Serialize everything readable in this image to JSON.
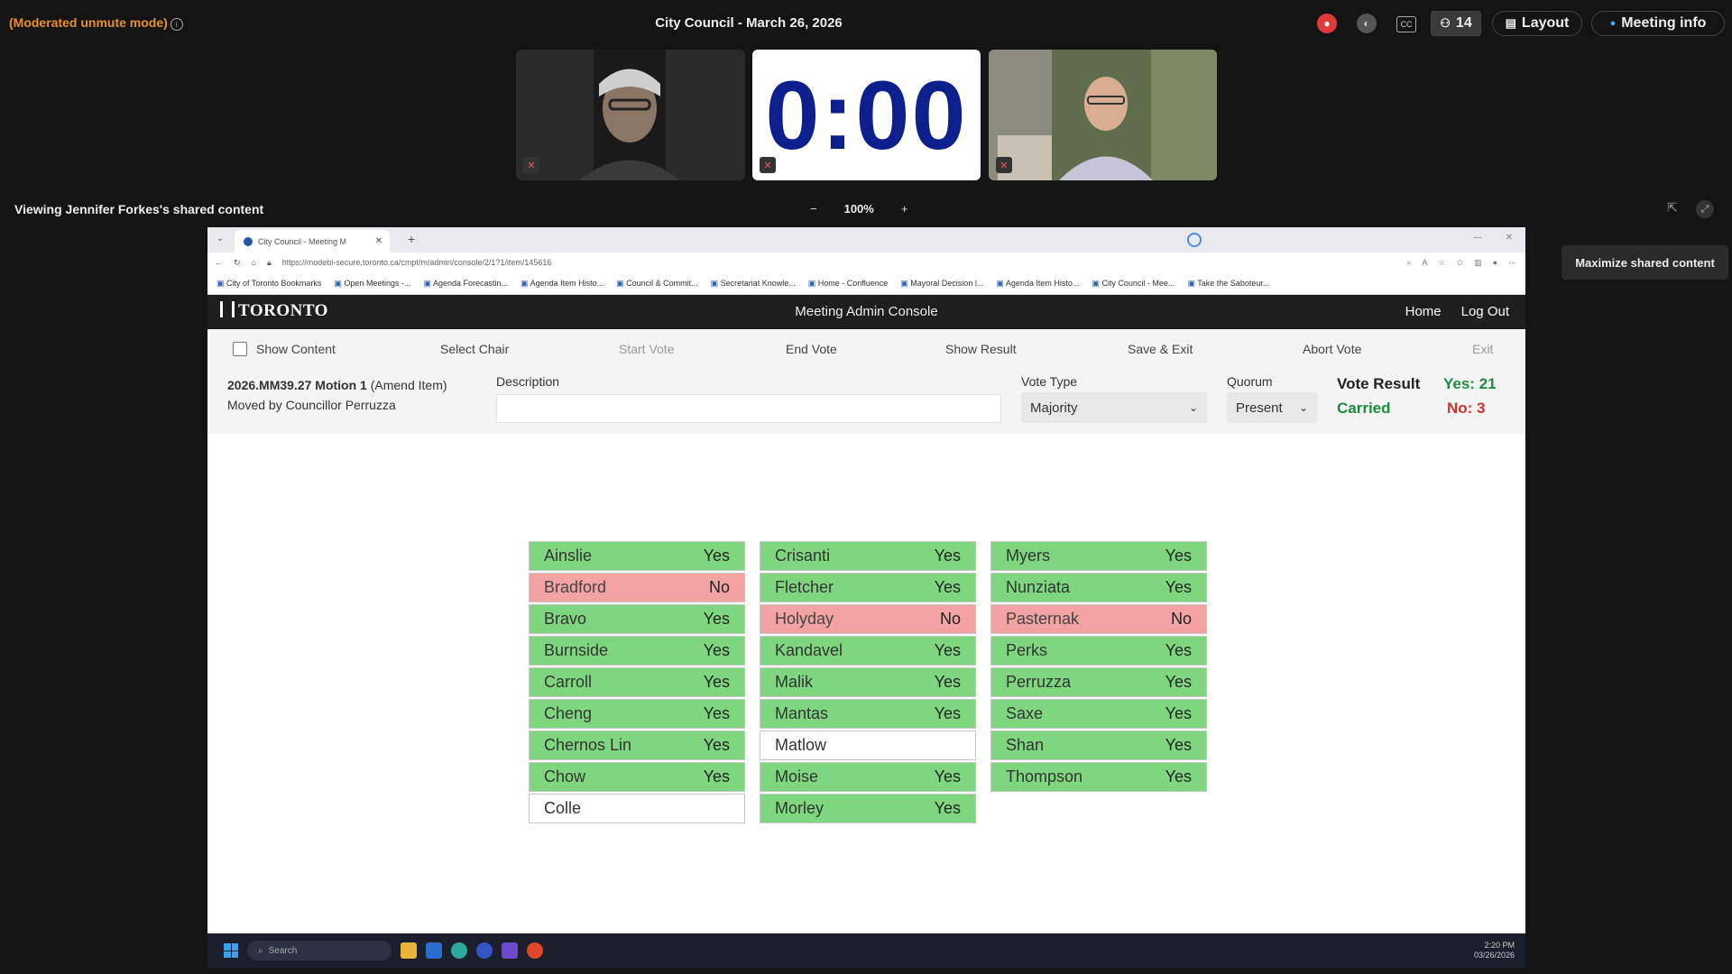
{
  "meeting": {
    "mode_label": "(Moderated unmute mode)",
    "title": "City Council - March 26, 2026",
    "participants_count": "14",
    "layout_label": "Layout",
    "meeting_info_label": "Meeting info",
    "timer": "0:00",
    "viewing_label": "Viewing Jennifer Forkes's shared content",
    "zoom_level": "100%",
    "zoom_minus": "−",
    "zoom_plus": "+",
    "tooltip": "Maximize shared content"
  },
  "browser": {
    "tab_title": "City Council - Meeting M",
    "url": "https://modebi-secure.toronto.ca/cmpt/m/admin/console/2/1?1/item/145616",
    "bookmarks": [
      "City of Toronto Bookmarks",
      "Open Meetings -...",
      "Agenda Forecastin...",
      "Agenda Item Histo...",
      "Council & Commit...",
      "Secretariat Knowle...",
      "Home - Confluence",
      "Mayoral Decision l...",
      "Agenda Item Histo...",
      "City Council - Mee...",
      "Take the Saboteur..."
    ]
  },
  "app": {
    "logo": "TORONTO",
    "console_title": "Meeting Admin Console",
    "nav_home": "Home",
    "nav_logout": "Log Out",
    "toolbar": {
      "show_content": "Show Content",
      "select_chair": "Select Chair",
      "start_vote": "Start Vote",
      "end_vote": "End Vote",
      "show_result": "Show Result",
      "save_exit": "Save & Exit",
      "abort_vote": "Abort Vote",
      "exit": "Exit"
    },
    "motion": {
      "id": "2026.MM39.27 Motion 1",
      "type": "(Amend Item)",
      "moved_by": "Moved by Councillor Perruzza",
      "description_label": "Description",
      "vote_type_label": "Vote Type",
      "vote_type_value": "Majority",
      "quorum_label": "Quorum",
      "quorum_value": "Present",
      "vote_result_label": "Vote Result",
      "result_status": "Carried",
      "yes_count": "Yes: 21",
      "no_count": "No: 3"
    },
    "colors": {
      "yes": "#7ed77f",
      "no": "#f3a4a2",
      "carried": "#1f8b3c",
      "no_text": "#d0312d"
    },
    "votes": [
      [
        {
          "name": "Ainslie",
          "vote": "Yes"
        },
        {
          "name": "Bradford",
          "vote": "No"
        },
        {
          "name": "Bravo",
          "vote": "Yes"
        },
        {
          "name": "Burnside",
          "vote": "Yes"
        },
        {
          "name": "Carroll",
          "vote": "Yes"
        },
        {
          "name": "Cheng",
          "vote": "Yes"
        },
        {
          "name": "Chernos Lin",
          "vote": "Yes"
        },
        {
          "name": "Chow",
          "vote": "Yes"
        },
        {
          "name": "Colle",
          "vote": ""
        }
      ],
      [
        {
          "name": "Crisanti",
          "vote": "Yes"
        },
        {
          "name": "Fletcher",
          "vote": "Yes"
        },
        {
          "name": "Holyday",
          "vote": "No"
        },
        {
          "name": "Kandavel",
          "vote": "Yes"
        },
        {
          "name": "Malik",
          "vote": "Yes"
        },
        {
          "name": "Mantas",
          "vote": "Yes"
        },
        {
          "name": "Matlow",
          "vote": ""
        },
        {
          "name": "Moise",
          "vote": "Yes"
        },
        {
          "name": "Morley",
          "vote": "Yes"
        }
      ],
      [
        {
          "name": "Myers",
          "vote": "Yes"
        },
        {
          "name": "Nunziata",
          "vote": "Yes"
        },
        {
          "name": "Pasternak",
          "vote": "No"
        },
        {
          "name": "Perks",
          "vote": "Yes"
        },
        {
          "name": "Perruzza",
          "vote": "Yes"
        },
        {
          "name": "Saxe",
          "vote": "Yes"
        },
        {
          "name": "Shan",
          "vote": "Yes"
        },
        {
          "name": "Thompson",
          "vote": "Yes"
        }
      ]
    ]
  },
  "taskbar": {
    "search_placeholder": "Search",
    "time": "2:20 PM",
    "date": "03/26/2026"
  }
}
